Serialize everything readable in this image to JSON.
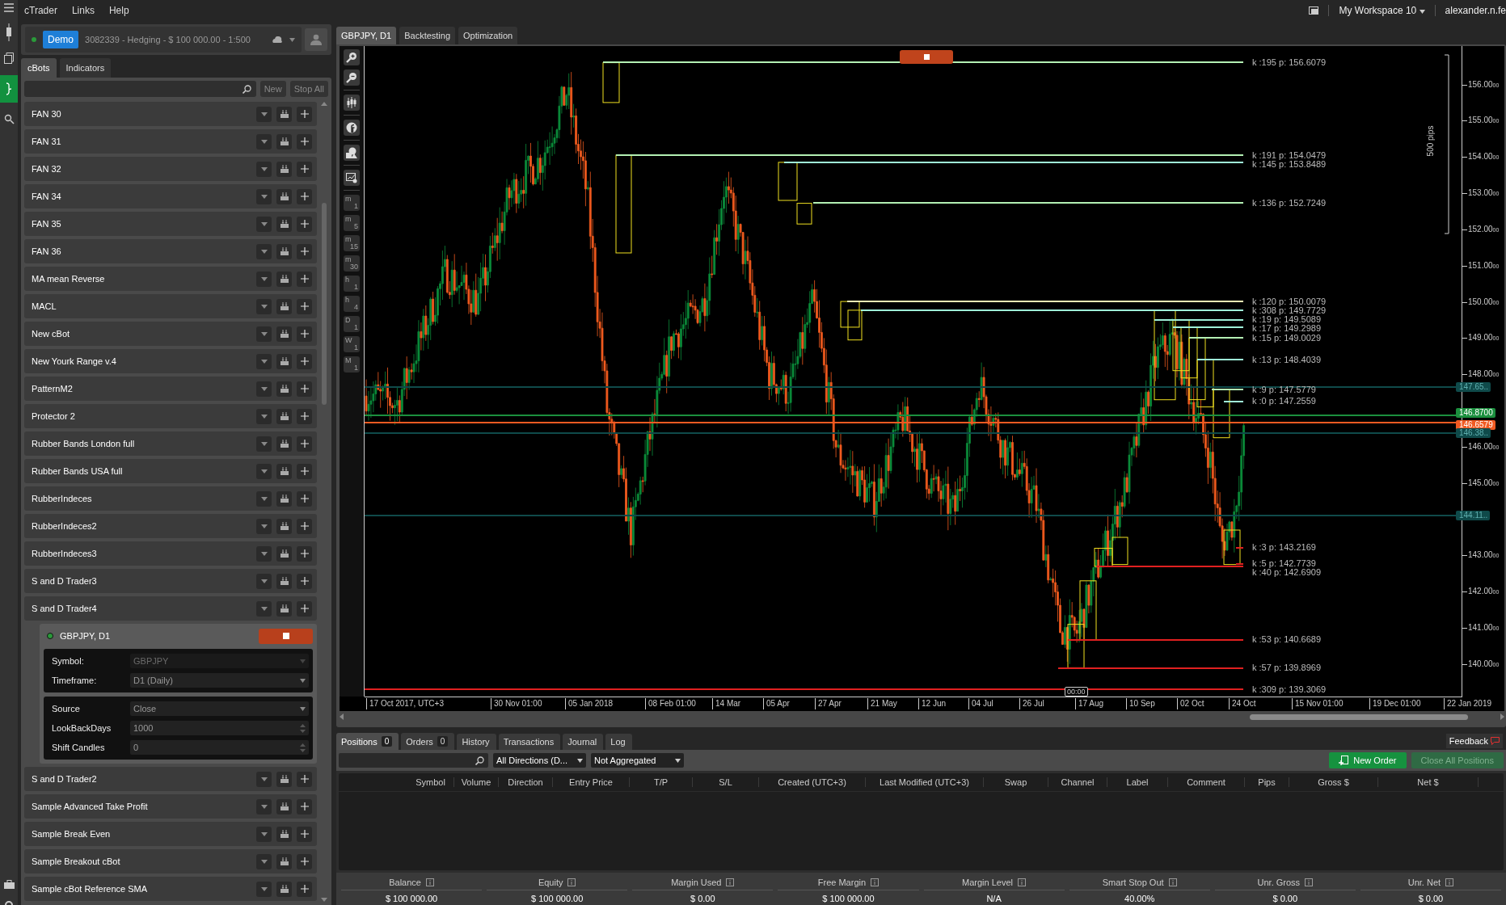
{
  "menu_bar": {
    "items": [
      "cTrader",
      "Links",
      "Help"
    ],
    "workspace": "My Workspace 10",
    "user": "alexander.n.fe"
  },
  "account": {
    "badge": "Demo",
    "connected": true,
    "text": "3082339 - Hedging - $ 100 000.00 - 1:500"
  },
  "left_tabs": [
    {
      "label": "cBots",
      "selected": true
    },
    {
      "label": "Indicators",
      "selected": false
    }
  ],
  "left_buttons": [
    "New",
    "Stop All"
  ],
  "cbots": [
    {
      "name": "FAN 30"
    },
    {
      "name": "FAN 31"
    },
    {
      "name": "FAN 32"
    },
    {
      "name": "FAN 34"
    },
    {
      "name": "FAN 35"
    },
    {
      "name": "FAN 36"
    },
    {
      "name": "MA mean Reverse"
    },
    {
      "name": "MACL"
    },
    {
      "name": "New cBot"
    },
    {
      "name": "New Yourk Range v.4"
    },
    {
      "name": "PatternM2"
    },
    {
      "name": "Protector 2"
    },
    {
      "name": "Rubber Bands  London full"
    },
    {
      "name": "Rubber Bands  USA full"
    },
    {
      "name": "RubberIndeces"
    },
    {
      "name": "RubberIndeces2"
    },
    {
      "name": "RubberIndeces3"
    },
    {
      "name": "S and  D Trader3"
    },
    {
      "name": "S and  D Trader4",
      "instance": {
        "title": "GBPJPY, D1",
        "running": true,
        "groups": [
          {
            "params": [
              {
                "label": "Symbol:",
                "value": "GBPJPY",
                "kind": "dropdown",
                "disabled": true
              },
              {
                "label": "Timeframe:",
                "value": "D1 (Daily)",
                "kind": "dropdown",
                "disabled": false
              }
            ]
          },
          {
            "params": [
              {
                "label": "Source",
                "value": "Close",
                "kind": "dropdown",
                "disabled": false
              },
              {
                "label": "LookBackDays",
                "value": "1000",
                "kind": "spinner",
                "disabled": false
              },
              {
                "label": "Shift Candles",
                "value": "0",
                "kind": "spinner",
                "disabled": false
              }
            ]
          }
        ]
      }
    },
    {
      "name": "S and D Trader2"
    },
    {
      "name": "Sample Advanced Take Profit"
    },
    {
      "name": "Sample Break Even"
    },
    {
      "name": "Sample Breakout cBot"
    },
    {
      "name": "Sample cBot Reference SMA"
    }
  ],
  "chart_tabs": [
    {
      "label": "GBPJPY, D1",
      "selected": true
    },
    {
      "label": "Backtesting",
      "selected": false
    },
    {
      "label": "Optimization",
      "selected": false
    }
  ],
  "chart": {
    "bot_running": true,
    "timeframes": [
      {
        "letter": "m",
        "number": "1"
      },
      {
        "letter": "m",
        "number": "5"
      },
      {
        "letter": "m",
        "number": "15"
      },
      {
        "letter": "m",
        "number": "30"
      },
      {
        "letter": "h",
        "number": "1"
      },
      {
        "letter": "h",
        "number": "4"
      },
      {
        "letter": "D",
        "number": "1"
      },
      {
        "letter": "W",
        "number": "1"
      },
      {
        "letter": "M",
        "number": "1"
      }
    ],
    "levels": [
      {
        "text": "k :195 p: 156.6079",
        "color": "#b4f0b4"
      },
      {
        "text": "k :191 p: 154.0479",
        "color": "#b4f0b4"
      },
      {
        "text": "k :145 p: 153.8489",
        "color": "#9ff0d8"
      },
      {
        "text": "k :136 p: 152.7249",
        "color": "#b4f0b4"
      },
      {
        "text": "k :120 p: 150.0079",
        "color": "#f0f0b4"
      },
      {
        "text": "k :308 p: 149.7729",
        "color": "#9ff0d8"
      },
      {
        "text": "k :19 p: 149.5089",
        "color": "#9ff0d8"
      },
      {
        "text": "k :17 p: 149.2989",
        "color": "#9ff0d8"
      },
      {
        "text": "k :15 p: 149.0029",
        "color": "#b4f0b4"
      },
      {
        "text": "k :13 p: 148.4039",
        "color": "#9ff0d8"
      },
      {
        "text": "k :9 p: 147.5779",
        "color": "#b4f0b4"
      },
      {
        "text": "k :0 p: 147.2559",
        "color": "#9ff0d8"
      },
      {
        "text": "k :3 p: 143.2169",
        "color": "#e02020"
      },
      {
        "text": "k :5 p: 142.7739",
        "color": "#e02020"
      },
      {
        "text": "k :40 p: 142.6909",
        "color": "#e02020"
      },
      {
        "text": "k :53 p: 140.6689",
        "color": "#e02020"
      },
      {
        "text": "k :57 p: 139.8969",
        "color": "#e02020"
      },
      {
        "text": "k :309 p: 139.3069",
        "color": "#e02020"
      }
    ],
    "price_axis": [
      {
        "major": "156.00",
        "minor": "00"
      },
      {
        "major": "155.00",
        "minor": "00"
      },
      {
        "major": "154.00",
        "minor": "00"
      },
      {
        "major": "153.00",
        "minor": "00"
      },
      {
        "major": "152.00",
        "minor": "00"
      },
      {
        "major": "151.00",
        "minor": "00"
      },
      {
        "major": "150.00",
        "minor": "00"
      },
      {
        "major": "149.00",
        "minor": "00"
      },
      {
        "major": "148.00",
        "minor": "00"
      },
      {
        "major": "146.00",
        "minor": "00"
      },
      {
        "major": "145.00",
        "minor": "00"
      },
      {
        "major": "143.00",
        "minor": "00"
      },
      {
        "major": "142.00",
        "minor": "00"
      },
      {
        "major": "141.00",
        "minor": "00"
      },
      {
        "major": "140.00",
        "minor": "00"
      }
    ],
    "price_tags": [
      {
        "text": "147.65..",
        "color": "#0f4a4a"
      },
      {
        "text": "146.8700",
        "color": "#1b8f3e"
      },
      {
        "text": "146.6579",
        "color": "#f05a22"
      },
      {
        "text": "146.38..",
        "color": "#0f4a4a"
      },
      {
        "text": "144.11..",
        "color": "#0f4a4a"
      }
    ],
    "scale_label": "500 pips",
    "time_axis": [
      "17 Oct 2017, UTC+3",
      "30 Nov 01:00",
      "05 Jan 2018",
      "08 Feb 01:00",
      "14 Mar",
      "05 Apr",
      "27 Apr",
      "21 May",
      "12 Jun",
      "04 Jul",
      "26 Jul",
      "17 Aug",
      "10 Sep",
      "02 Oct",
      "24 Oct",
      "15 Nov 01:00",
      "19 Dec 01:00",
      "22 Jan 2019"
    ],
    "crosshair_time": "00:00"
  },
  "bottom_tabs": [
    {
      "label": "Positions",
      "count": "0",
      "selected": true
    },
    {
      "label": "Orders",
      "count": "0",
      "selected": false
    },
    {
      "label": "History",
      "selected": false
    },
    {
      "label": "Transactions",
      "selected": false
    },
    {
      "label": "Journal",
      "selected": false
    },
    {
      "label": "Log",
      "selected": false
    }
  ],
  "feedback": "Feedback",
  "filters": {
    "direction": "All Directions (D...",
    "aggregation": "Not Aggregated"
  },
  "actions": [
    {
      "label": "New Order",
      "kind": "primary",
      "disabled": false
    },
    {
      "label": "Close All Positions",
      "kind": "secondary",
      "disabled": true
    }
  ],
  "columns": [
    "Symbol",
    "Volume",
    "Direction",
    "Entry Price",
    "T/P",
    "S/L",
    "Created (UTC+3)",
    "Last Modified (UTC+3)",
    "Swap",
    "Channel",
    "Label",
    "Comment",
    "Pips",
    "Gross $",
    "Net $"
  ],
  "summary": [
    {
      "label": "Balance",
      "value": "$ 100 000.00"
    },
    {
      "label": "Equity",
      "value": "$ 100 000.00"
    },
    {
      "label": "Margin Used",
      "value": "$ 0.00"
    },
    {
      "label": "Free Margin",
      "value": "$ 100 000.00"
    },
    {
      "label": "Margin Level",
      "value": "N/A"
    },
    {
      "label": "Smart Stop Out",
      "value": "40.00%"
    },
    {
      "label": "Unr. Gross",
      "value": "$ 0.00"
    },
    {
      "label": "Unr. Net",
      "value": "$ 0.00"
    }
  ]
}
